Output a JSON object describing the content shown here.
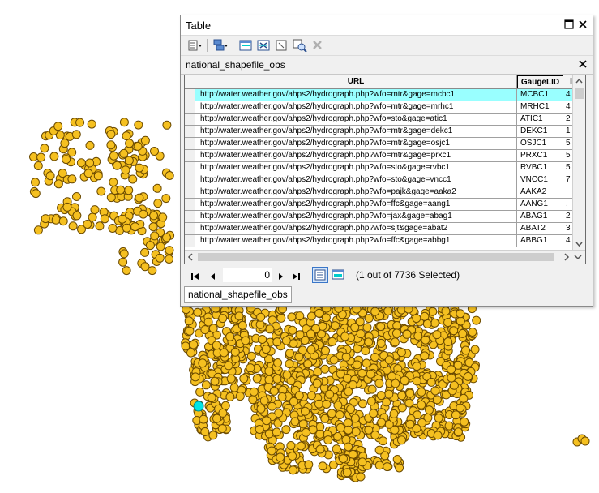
{
  "window": {
    "title": "Table"
  },
  "layer_bar": {
    "name": "national_shapefile_obs"
  },
  "table": {
    "columns": [
      "URL",
      "GaugeLID"
    ],
    "rows": [
      {
        "url": "http://water.weather.gov/ahps2/hydrograph.php?wfo=mtr&gage=mcbc1",
        "lid": "MCBC1",
        "extra": "4",
        "selected": true
      },
      {
        "url": "http://water.weather.gov/ahps2/hydrograph.php?wfo=mtr&gage=mrhc1",
        "lid": "MRHC1",
        "extra": "4"
      },
      {
        "url": "http://water.weather.gov/ahps2/hydrograph.php?wfo=sto&gage=atic1",
        "lid": "ATIC1",
        "extra": "2"
      },
      {
        "url": "http://water.weather.gov/ahps2/hydrograph.php?wfo=mtr&gage=dekc1",
        "lid": "DEKC1",
        "extra": "1"
      },
      {
        "url": "http://water.weather.gov/ahps2/hydrograph.php?wfo=mtr&gage=osjc1",
        "lid": "OSJC1",
        "extra": "5"
      },
      {
        "url": "http://water.weather.gov/ahps2/hydrograph.php?wfo=mtr&gage=prxc1",
        "lid": "PRXC1",
        "extra": "5"
      },
      {
        "url": "http://water.weather.gov/ahps2/hydrograph.php?wfo=sto&gage=rvbc1",
        "lid": "RVBC1",
        "extra": "5"
      },
      {
        "url": "http://water.weather.gov/ahps2/hydrograph.php?wfo=sto&gage=vncc1",
        "lid": "VNCC1",
        "extra": "7"
      },
      {
        "url": "http://water.weather.gov/ahps2/hydrograph.php?wfo=pajk&gage=aaka2",
        "lid": "AAKA2",
        "extra": ""
      },
      {
        "url": "http://water.weather.gov/ahps2/hydrograph.php?wfo=ffc&gage=aang1",
        "lid": "AANG1",
        "extra": "."
      },
      {
        "url": "http://water.weather.gov/ahps2/hydrograph.php?wfo=jax&gage=abag1",
        "lid": "ABAG1",
        "extra": "2"
      },
      {
        "url": "http://water.weather.gov/ahps2/hydrograph.php?wfo=sjt&gage=abat2",
        "lid": "ABAT2",
        "extra": "3"
      },
      {
        "url": "http://water.weather.gov/ahps2/hydrograph.php?wfo=ffc&gage=abbg1",
        "lid": "ABBG1",
        "extra": "4"
      }
    ]
  },
  "navigation": {
    "record": "0",
    "selection_text": "(1 out of 7736 Selected)"
  },
  "tab": {
    "label": "national_shapefile_obs"
  },
  "colors": {
    "point_fill": "#f5c020",
    "point_stroke": "#6b4a00",
    "selected_point": "#00e5e5",
    "selected_row": "#99ffff"
  }
}
